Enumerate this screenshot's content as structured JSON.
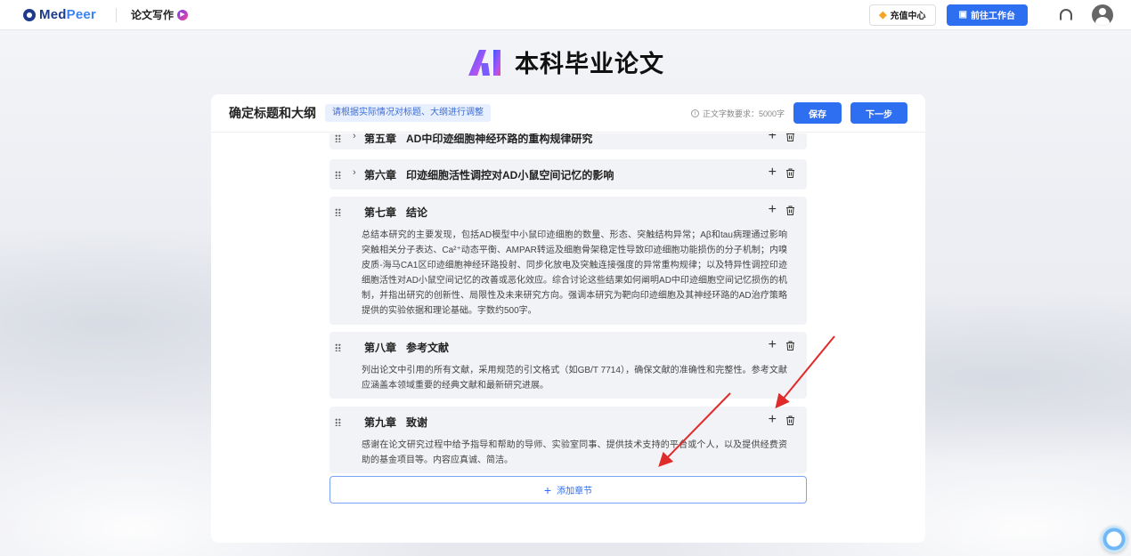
{
  "topbar": {
    "logo_text_a": "Med",
    "logo_text_b": "Peer",
    "module_name": "论文写作",
    "recharge_label": "充值中心",
    "workspace_label": "前往工作台"
  },
  "page": {
    "title": "本科毕业论文"
  },
  "card": {
    "title": "确定标题和大纲",
    "tip": "请根据实际情况对标题、大纲进行调整",
    "wordcount": "正文字数要求：5000字",
    "save_label": "保存",
    "next_label": "下一步"
  },
  "chapters": [
    {
      "num": "第五章",
      "title": "AD中印迹细胞神经环路的重构规律研究",
      "collapsed": true
    },
    {
      "num": "第六章",
      "title": "印迹细胞活性调控对AD小鼠空间记忆的影响",
      "collapsed": true
    },
    {
      "num": "第七章",
      "title": "结论",
      "desc": "总结本研究的主要发现，包括AD模型中小鼠印迹细胞的数量、形态、突触结构异常；Aβ和tau病理通过影响突触相关分子表达、Ca²⁺动态平衡、AMPAR转运及细胞骨架稳定性导致印迹细胞功能损伤的分子机制；内嗅皮质-海马CA1区印迹细胞神经环路投射、同步化放电及突触连接强度的异常重构规律；以及特异性调控印迹细胞活性对AD小鼠空间记忆的改善或恶化效应。综合讨论这些结果如何阐明AD中印迹细胞空间记忆损伤的机制，并指出研究的创新性、局限性及未来研究方向。强调本研究为靶向印迹细胞及其神经环路的AD治疗策略提供的实验依据和理论基础。字数约500字。"
    },
    {
      "num": "第八章",
      "title": "参考文献",
      "desc": "列出论文中引用的所有文献，采用规范的引文格式（如GB/T 7714），确保文献的准确性和完整性。参考文献应涵盖本领域重要的经典文献和最新研究进展。"
    },
    {
      "num": "第九章",
      "title": "致谢",
      "desc": "感谢在论文研究过程中给予指导和帮助的导师、实验室同事、提供技术支持的平台或个人，以及提供经费资助的基金项目等。内容应真诚、简洁。"
    }
  ],
  "add_chapter_label": "添加章节",
  "colors": {
    "primary": "#2e6ef0",
    "annotation_arrow": "#e02b2b"
  }
}
